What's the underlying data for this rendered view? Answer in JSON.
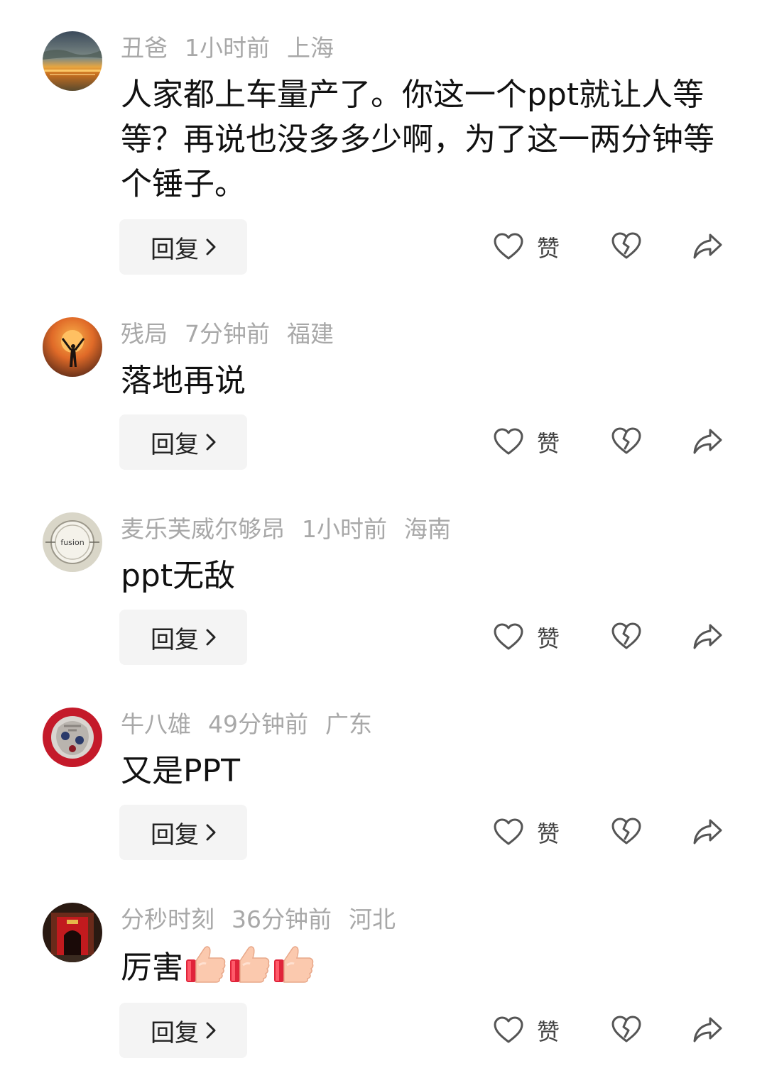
{
  "colors": {
    "meta_text": "#a8a8a8",
    "body_text": "#111111",
    "button_bg": "#f4f4f4",
    "icon_stroke": "#555555"
  },
  "comments": [
    {
      "author": "丑爸",
      "time": "1小时前",
      "location": "上海",
      "text": "人家都上车量产了。你这一个ppt就让人等等？再说也没多多少啊，为了这一两分钟等个锤子。",
      "reply_label": "回复",
      "like_label": "赞",
      "avatar_icon": "sunset-lake-avatar"
    },
    {
      "author": "残局",
      "time": "7分钟前",
      "location": "福建",
      "text": "落地再说",
      "reply_label": "回复",
      "like_label": "赞",
      "avatar_icon": "sun-silhouette-avatar"
    },
    {
      "author": "麦乐芙威尔够昂",
      "time": "1小时前",
      "location": "海南",
      "text": "ppt无敌",
      "reply_label": "回复",
      "like_label": "赞",
      "avatar_icon": "fusion-logo-avatar",
      "avatar_logo_text": "fusion"
    },
    {
      "author": "牛八雄",
      "time": "49分钟前",
      "location": "广东",
      "text": "又是PPT",
      "reply_label": "回复",
      "like_label": "赞",
      "avatar_icon": "fu-character-avatar"
    },
    {
      "author": "分秒时刻",
      "time": "36分钟前",
      "location": "河北",
      "text": "厉害",
      "emojis": [
        "thumbs-up-icon",
        "thumbs-up-icon",
        "thumbs-up-icon"
      ],
      "reply_label": "回复",
      "like_label": "赞",
      "avatar_icon": "red-gate-avatar"
    }
  ]
}
